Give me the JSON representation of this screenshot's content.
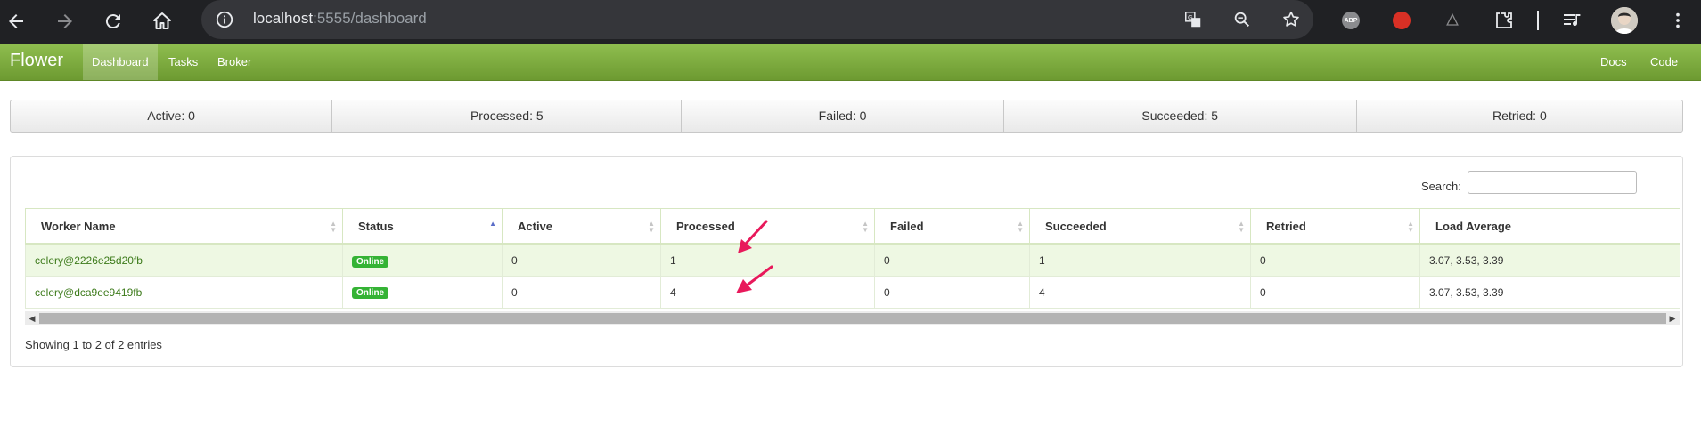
{
  "browser": {
    "url_host": "localhost",
    "url_path": ":5555/dashboard",
    "icons": [
      "back-icon",
      "forward-icon",
      "reload-icon",
      "home-icon",
      "site-info-icon",
      "translate-icon",
      "zoom-icon",
      "bookmark-star-icon",
      "adblock-icon",
      "stop-hand-icon",
      "puzzle-icon",
      "extensions-icon",
      "media-queue-icon",
      "profile-avatar",
      "menu-kebab-icon"
    ],
    "abp_text": "ABP"
  },
  "nav": {
    "brand": "Flower",
    "links": [
      "Dashboard",
      "Tasks",
      "Broker"
    ],
    "active": "Dashboard",
    "right_links": [
      "Docs",
      "Code"
    ]
  },
  "summary": {
    "active": "Active: 0",
    "processed": "Processed: 5",
    "failed": "Failed: 0",
    "succeeded": "Succeeded: 5",
    "retried": "Retried: 0"
  },
  "search": {
    "label": "Search:",
    "value": ""
  },
  "table": {
    "columns": [
      "Worker Name",
      "Status",
      "Active",
      "Processed",
      "Failed",
      "Succeeded",
      "Retried",
      "Load Average"
    ],
    "sorted_column": "Status",
    "rows": [
      {
        "worker": "celery@2226e25d20fb",
        "status": "Online",
        "active": "0",
        "processed": "1",
        "failed": "0",
        "succeeded": "1",
        "retried": "0",
        "load": "3.07, 3.53, 3.39"
      },
      {
        "worker": "celery@dca9ee9419fb",
        "status": "Online",
        "active": "0",
        "processed": "4",
        "failed": "0",
        "succeeded": "4",
        "retried": "0",
        "load": "3.07, 3.53, 3.39"
      }
    ]
  },
  "footer": {
    "entries": "Showing 1 to 2 of 2 entries"
  },
  "colors": {
    "navbar": "#7aa93e",
    "badge": "#35b335",
    "annotation_arrow": "#e8195b",
    "link": "#3c7a1a"
  }
}
